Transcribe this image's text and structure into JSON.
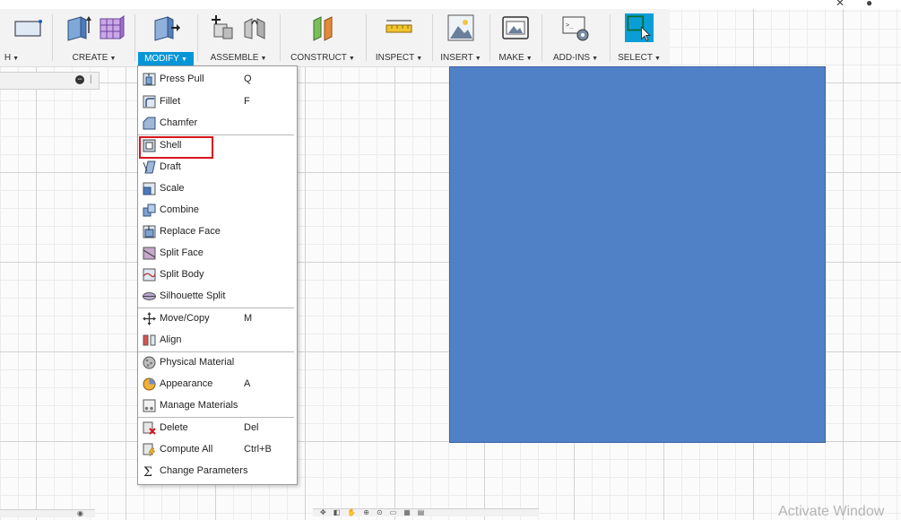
{
  "toolbar": {
    "groups": [
      {
        "label": "H"
      },
      {
        "label": "CREATE"
      },
      {
        "label": "MODIFY"
      },
      {
        "label": "ASSEMBLE"
      },
      {
        "label": "CONSTRUCT"
      },
      {
        "label": "INSPECT"
      },
      {
        "label": "INSERT"
      },
      {
        "label": "MAKE"
      },
      {
        "label": "ADD-INS"
      },
      {
        "label": "SELECT"
      }
    ],
    "active": "MODIFY",
    "accent": "#0696d7"
  },
  "modify_menu": {
    "items": [
      {
        "label": "Press Pull",
        "shortcut": "Q"
      },
      {
        "label": "Fillet",
        "shortcut": "F"
      },
      {
        "label": "Chamfer",
        "shortcut": ""
      },
      {
        "label": "Shell",
        "shortcut": ""
      },
      {
        "label": "Draft",
        "shortcut": ""
      },
      {
        "label": "Scale",
        "shortcut": ""
      },
      {
        "label": "Combine",
        "shortcut": ""
      },
      {
        "label": "Replace Face",
        "shortcut": ""
      },
      {
        "label": "Split Face",
        "shortcut": ""
      },
      {
        "label": "Split Body",
        "shortcut": ""
      },
      {
        "label": "Silhouette Split",
        "shortcut": ""
      },
      {
        "label": "Move/Copy",
        "shortcut": "M"
      },
      {
        "label": "Align",
        "shortcut": ""
      },
      {
        "label": "Physical Material",
        "shortcut": ""
      },
      {
        "label": "Appearance",
        "shortcut": "A"
      },
      {
        "label": "Manage Materials",
        "shortcut": ""
      },
      {
        "label": "Delete",
        "shortcut": "Del"
      },
      {
        "label": "Compute All",
        "shortcut": "Ctrl+B"
      },
      {
        "label": "Change Parameters",
        "shortcut": ""
      }
    ],
    "highlighted": "Shell",
    "highlight_color": "#d9151c"
  },
  "canvas": {
    "body_color": "#5081c6"
  },
  "watermark": "Activate Window"
}
